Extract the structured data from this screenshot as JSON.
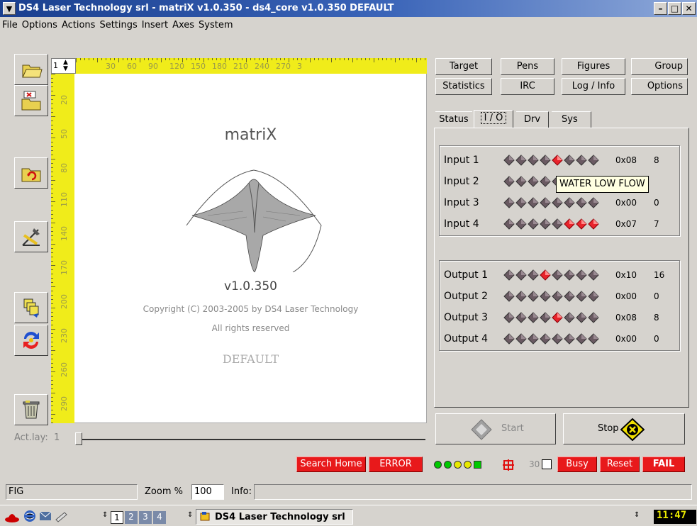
{
  "window": {
    "title": "DS4 Laser Technology srl - matriX v1.0.350 - ds4_core v1.0.350   DEFAULT"
  },
  "menu": [
    "File",
    "Options",
    "Actions",
    "Settings",
    "Insert",
    "Axes",
    "System"
  ],
  "toolbar": {
    "tools": [
      {
        "icon": "open-folder-icon"
      },
      {
        "icon": "import-folder-icon"
      },
      {
        "icon": "reload-folder-icon"
      },
      {
        "icon": "edit-drawing-icon"
      },
      {
        "icon": "layers-icon"
      },
      {
        "icon": "refresh-arrows-icon"
      },
      {
        "icon": "trash-icon"
      }
    ]
  },
  "ruler": {
    "layer_value": "1",
    "top_labels": [
      "30",
      "60",
      "90",
      "120",
      "150",
      "180",
      "210",
      "240",
      "270",
      "3"
    ],
    "left_labels": [
      "20",
      "50",
      "80",
      "110",
      "140",
      "170",
      "200",
      "230",
      "260",
      "290"
    ]
  },
  "canvas": {
    "app_name": "matriX",
    "version": "v1.0.350",
    "copyright": "Copyright (C) 2003-2005 by DS4 Laser Technology",
    "rights": "All rights reserved",
    "profile": "DEFAULT"
  },
  "actlay": {
    "label": "Act.lay:",
    "value": "1"
  },
  "tabs_row1": [
    "Target",
    "Pens",
    "Figures",
    "Group"
  ],
  "tabs_row2": [
    "Statistics",
    "IRC",
    "Log / Info",
    "Options"
  ],
  "subtabs": [
    "Status",
    "I / O",
    "Drv",
    "Sys"
  ],
  "inputs": [
    {
      "label": "Input 1",
      "leds": [
        0,
        0,
        0,
        0,
        1,
        0,
        0,
        0
      ],
      "hex": "0x08",
      "dec": "8"
    },
    {
      "label": "Input 2",
      "leds": [
        0,
        0,
        0,
        0,
        0,
        0,
        0,
        0
      ],
      "hex": "",
      "dec": ""
    },
    {
      "label": "Input 3",
      "leds": [
        0,
        0,
        0,
        0,
        0,
        0,
        0,
        0
      ],
      "hex": "0x00",
      "dec": "0"
    },
    {
      "label": "Input 4",
      "leds": [
        0,
        0,
        0,
        0,
        0,
        1,
        1,
        1
      ],
      "hex": "0x07",
      "dec": "7"
    }
  ],
  "outputs": [
    {
      "label": "Output 1",
      "leds": [
        0,
        0,
        0,
        1,
        0,
        0,
        0,
        0
      ],
      "hex": "0x10",
      "dec": "16"
    },
    {
      "label": "Output 2",
      "leds": [
        0,
        0,
        0,
        0,
        0,
        0,
        0,
        0
      ],
      "hex": "0x00",
      "dec": "0"
    },
    {
      "label": "Output 3",
      "leds": [
        0,
        0,
        0,
        0,
        1,
        0,
        0,
        0
      ],
      "hex": "0x08",
      "dec": "8"
    },
    {
      "label": "Output 4",
      "leds": [
        0,
        0,
        0,
        0,
        0,
        0,
        0,
        0
      ],
      "hex": "0x00",
      "dec": "0"
    }
  ],
  "tooltip": "WATER LOW FLOW",
  "actions": {
    "start_label": "Start",
    "stop_label": "Stop"
  },
  "status_indicators": {
    "search_home": "Search Home",
    "error": "ERROR",
    "counter": "30",
    "busy": "Busy",
    "reset": "Reset",
    "fail": "FAIL",
    "led_colors": [
      "#00c800",
      "#00c800",
      "#e8e800",
      "#e8e800",
      "#00c800"
    ]
  },
  "statusbar": {
    "mode": "FIG",
    "zoom_label": "Zoom %",
    "zoom_value": "100",
    "info_label": "Info:",
    "info_value": ""
  },
  "taskbar": {
    "desktops": [
      "1",
      "2",
      "3",
      "4"
    ],
    "task": "DS4 Laser Technology srl",
    "clock": "11:47"
  }
}
